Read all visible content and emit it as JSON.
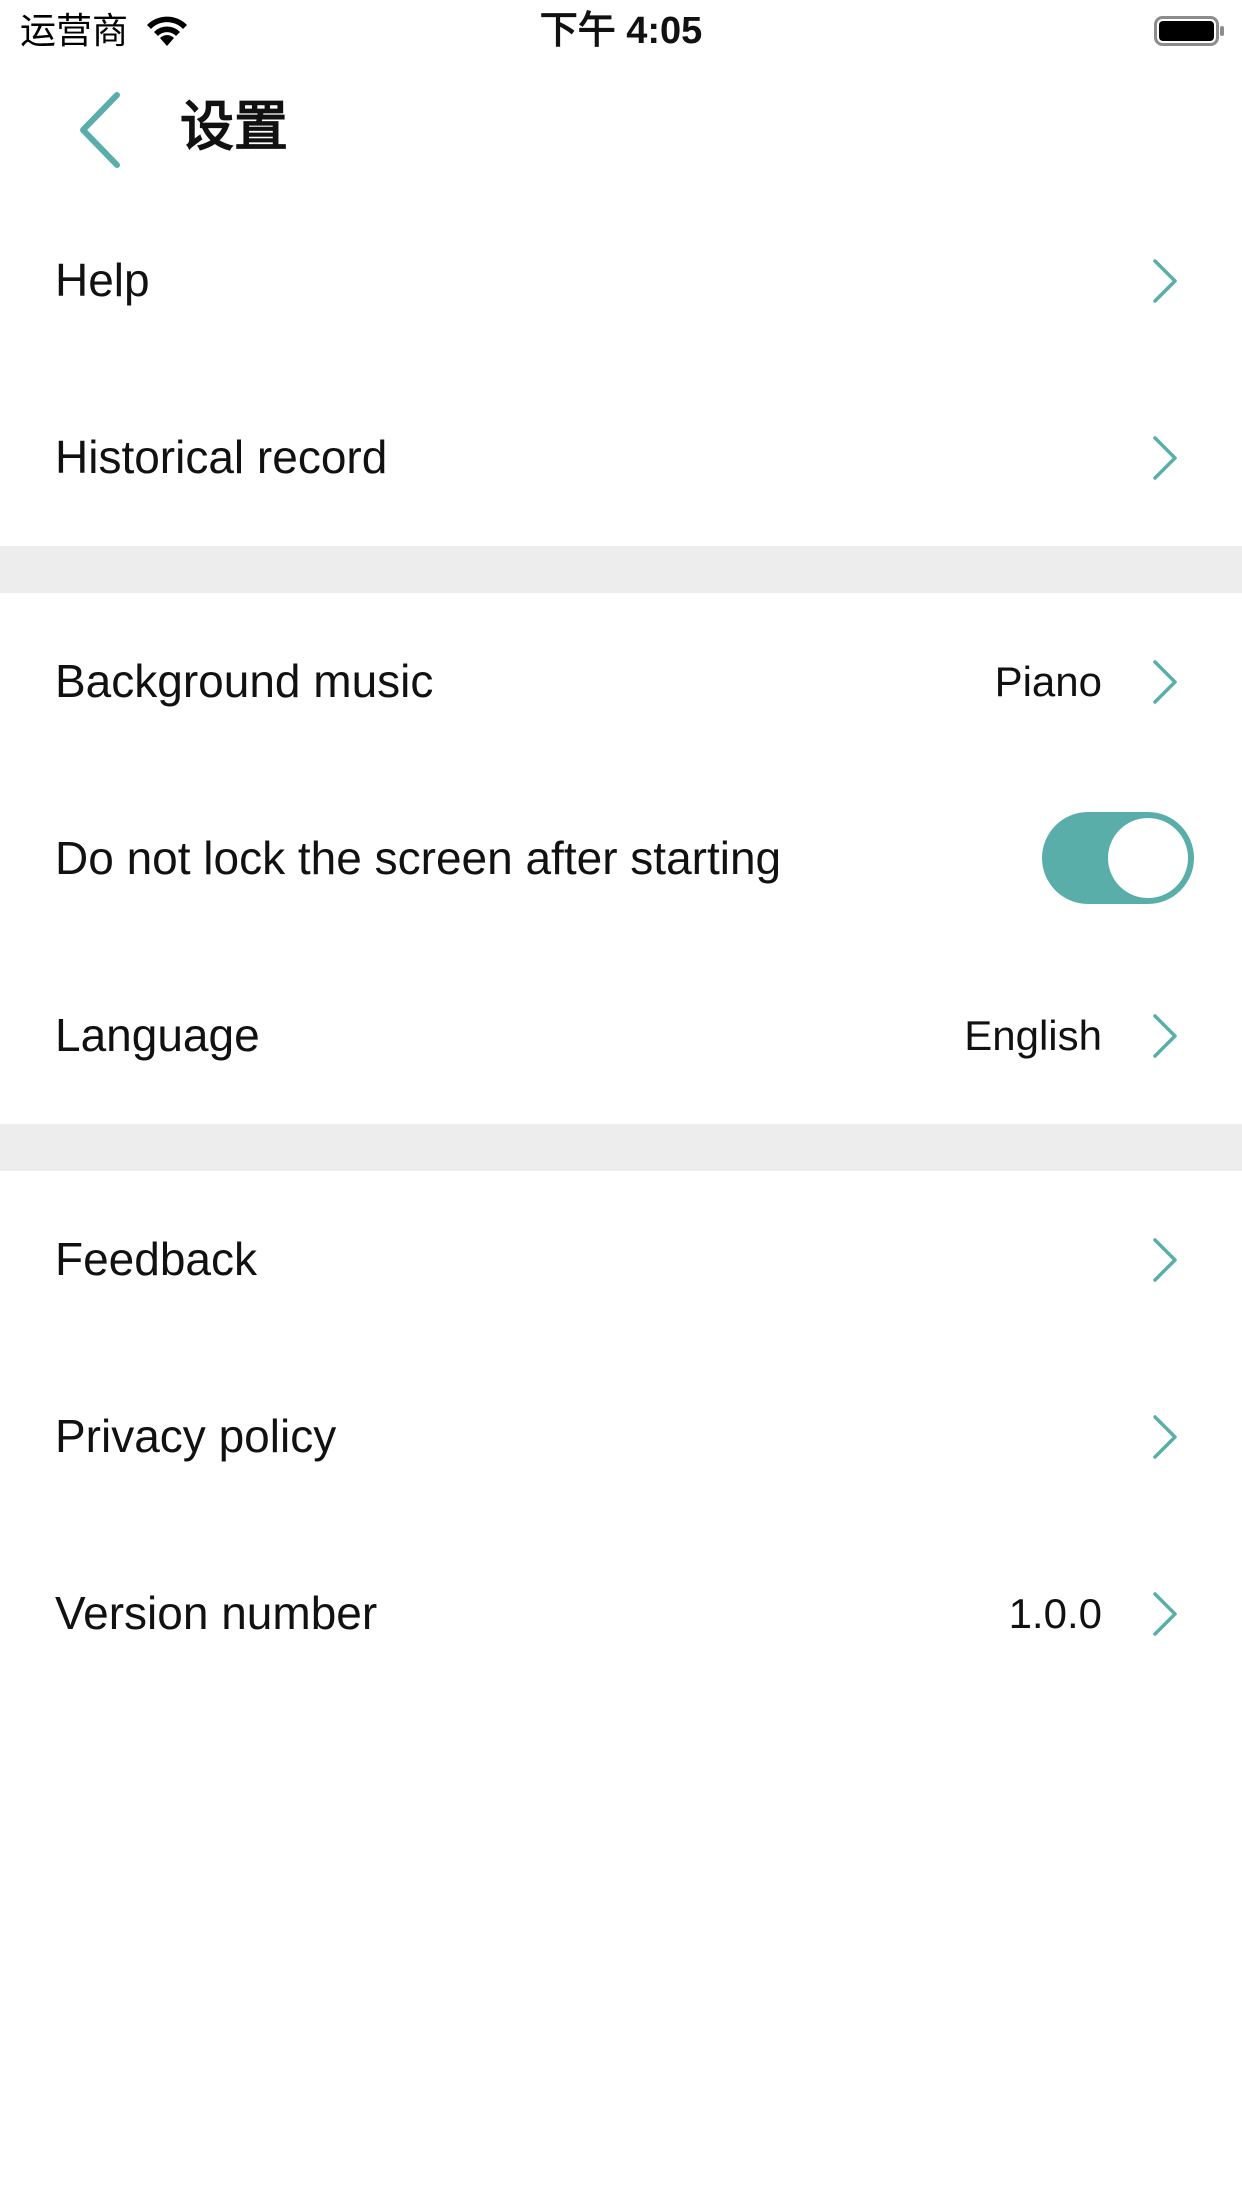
{
  "status_bar": {
    "carrier": "运营商",
    "time": "下午 4:05",
    "wifi_icon": "wifi-icon",
    "battery_icon": "battery-icon"
  },
  "nav": {
    "title": "设置",
    "back_icon": "chevron-left-icon"
  },
  "colors": {
    "accent": "#5aaeaa",
    "section_gap": "#ededed",
    "text": "#111111"
  },
  "sections": [
    {
      "rows": [
        {
          "label": "Help",
          "value": "",
          "type": "link"
        },
        {
          "label": "Historical record",
          "value": "",
          "type": "link"
        }
      ]
    },
    {
      "rows": [
        {
          "label": "Background music",
          "value": "Piano",
          "type": "link"
        },
        {
          "label": "Do not lock the screen after starting",
          "value": "",
          "type": "toggle",
          "on": true
        },
        {
          "label": "Language",
          "value": "English",
          "type": "link"
        }
      ]
    },
    {
      "rows": [
        {
          "label": "Feedback",
          "value": "",
          "type": "link"
        },
        {
          "label": "Privacy policy",
          "value": "",
          "type": "link"
        },
        {
          "label": "Version number",
          "value": "1.0.0",
          "type": "link"
        }
      ]
    }
  ]
}
